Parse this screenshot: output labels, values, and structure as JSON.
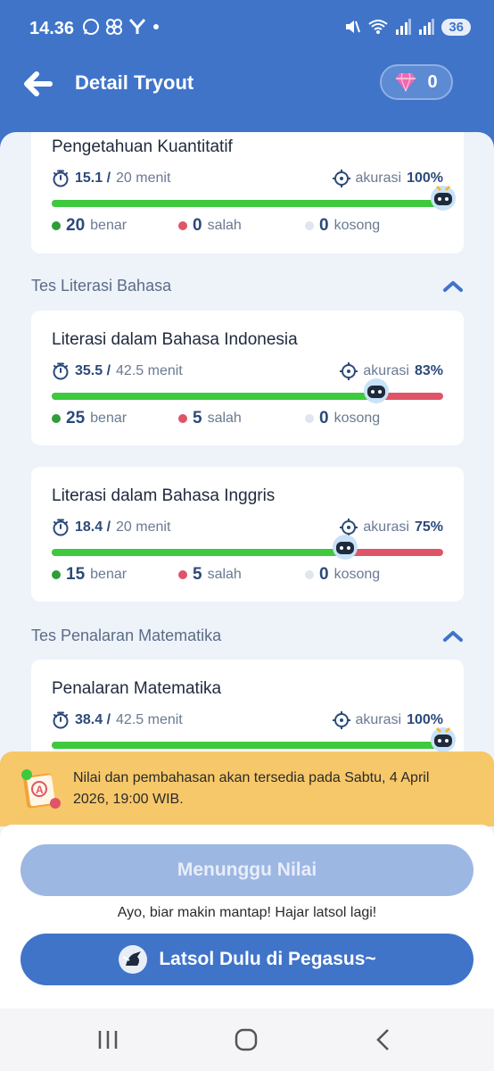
{
  "status_bar": {
    "time": "14.36",
    "left_icons": [
      "whatsapp-icon",
      "pinwheel-icon",
      "y-icon",
      "dot-icon"
    ],
    "right_icons": [
      "mute-icon",
      "wifi-icon",
      "signal-icon",
      "signal-icon"
    ],
    "battery": "36"
  },
  "app_bar": {
    "title": "Detail Tryout",
    "gems": "0"
  },
  "sections": {
    "literasi_title": "Tes Literasi Bahasa",
    "matematika_title": "Tes Penalaran Matematika"
  },
  "cards": [
    {
      "name": "Pengetahuan Kuantitatif",
      "time": "15.1 /",
      "time_total": "20 menit",
      "accuracy_label": "akurasi",
      "accuracy": "100%",
      "accuracy_fraction": 1.0,
      "benar": "20",
      "benar_label": "benar",
      "salah": "0",
      "salah_label": "salah",
      "kosong": "0",
      "kosong_label": "kosong"
    },
    {
      "name": "Literasi dalam Bahasa Indonesia",
      "time": "35.5 /",
      "time_total": "42.5 menit",
      "accuracy_label": "akurasi",
      "accuracy": "83%",
      "accuracy_fraction": 0.83,
      "benar": "25",
      "benar_label": "benar",
      "salah": "5",
      "salah_label": "salah",
      "kosong": "0",
      "kosong_label": "kosong"
    },
    {
      "name": "Literasi dalam Bahasa Inggris",
      "time": "18.4 /",
      "time_total": "20 menit",
      "accuracy_label": "akurasi",
      "accuracy": "75%",
      "accuracy_fraction": 0.75,
      "benar": "15",
      "benar_label": "benar",
      "salah": "5",
      "salah_label": "salah",
      "kosong": "0",
      "kosong_label": "kosong"
    },
    {
      "name": "Penalaran Matematika",
      "time": "38.4 /",
      "time_total": "42.5 menit",
      "accuracy_label": "akurasi",
      "accuracy": "100%",
      "accuracy_fraction": 1.0
    }
  ],
  "notice": {
    "text": "Nilai dan pembahasan akan tersedia pada Sabtu, 4 April 2026, 19:00 WIB."
  },
  "bottom": {
    "wait_button": "Menunggu Nilai",
    "hint": "Ayo, biar makin mantap! Hajar latsol lagi!",
    "latsol_button": "Latsol Dulu di Pegasus~"
  },
  "colors": {
    "brand": "#3f74c9",
    "correct": "#3ec93e",
    "wrong": "#e05468",
    "empty": "#dfe6f0",
    "notice": "#f7c86a"
  }
}
